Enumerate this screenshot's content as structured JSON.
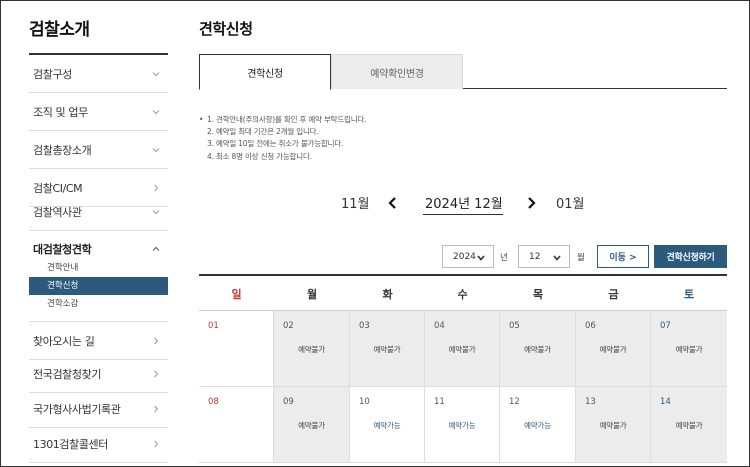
{
  "sidebar": {
    "title": "검찰소개",
    "items": [
      {
        "label": "검찰구성",
        "chevron": "down"
      },
      {
        "label": "조직 및 업무",
        "chevron": "down"
      },
      {
        "label": "검찰총장소개",
        "chevron": "down"
      },
      {
        "label": "검찰CI/CM",
        "chevron": "right"
      },
      {
        "label": "검찰역사관",
        "chevron": "down"
      }
    ],
    "group": {
      "label": "대검찰청견학",
      "chevron": "up",
      "subitems": [
        {
          "label": "견학안내",
          "active": false
        },
        {
          "label": "견학신청",
          "active": true
        },
        {
          "label": "견학소감",
          "active": false
        }
      ]
    },
    "items_after": [
      {
        "label": "찾아오시는 길",
        "chevron": "right"
      },
      {
        "label": "전국검찰청찾기",
        "chevron": "right"
      },
      {
        "label": "국가형사사법기록관",
        "chevron": "right"
      },
      {
        "label": "1301검찰콜센터",
        "chevron": "right"
      }
    ]
  },
  "main": {
    "title": "견학신청",
    "tabs": [
      {
        "label": "견학신청",
        "active": true
      },
      {
        "label": "예약확인변경",
        "active": false
      }
    ],
    "notice": [
      "1. 견학안내(주의사항)를 확인 후 예약 부탁드립니다.",
      "2. 예약일 최대 기간은 2개월 입니다.",
      "3. 예약일 10일 전에는 취소가 불가능합니다.",
      "4. 최소 8명 이상 신청 가능합니다."
    ],
    "month_nav": {
      "prev": "11월",
      "current": "2024년 12월",
      "next": "01월"
    },
    "controls": {
      "year_value": "2024",
      "year_unit": "년",
      "month_value": "12",
      "month_unit": "월",
      "move_label": "이동 >",
      "apply_label": "견학신청하기"
    },
    "calendar": {
      "weekdays": [
        "일",
        "월",
        "화",
        "수",
        "목",
        "금",
        "토"
      ],
      "weeks": [
        [
          {
            "day": "01",
            "status": ""
          },
          {
            "day": "02",
            "status": "예약불가"
          },
          {
            "day": "03",
            "status": "예약불가"
          },
          {
            "day": "04",
            "status": "예약불가"
          },
          {
            "day": "05",
            "status": "예약불가"
          },
          {
            "day": "06",
            "status": "예약불가"
          },
          {
            "day": "07",
            "status": "예약불가"
          }
        ],
        [
          {
            "day": "08",
            "status": ""
          },
          {
            "day": "09",
            "status": "예약불가"
          },
          {
            "day": "10",
            "status": "예약가능"
          },
          {
            "day": "11",
            "status": "예약가능"
          },
          {
            "day": "12",
            "status": "예약가능"
          },
          {
            "day": "13",
            "status": "예약불가"
          },
          {
            "day": "14",
            "status": "예약불가"
          }
        ]
      ]
    }
  },
  "colors": {
    "accent": "#2b5a7d",
    "sunday": "#c0392b",
    "saturday": "#2b5a7d",
    "unavailable_bg": "#ececec"
  }
}
